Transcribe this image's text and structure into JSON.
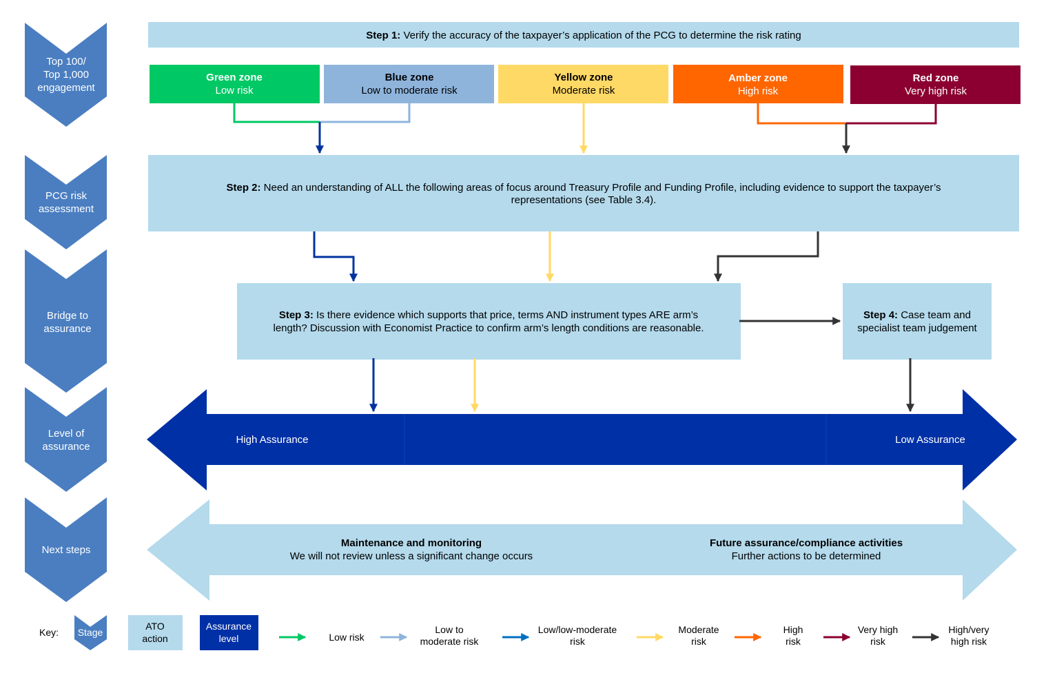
{
  "colors": {
    "stage": "#4a7ec1",
    "ato_action": "#b4daec",
    "assurance_level": "#0030a6",
    "green": "#00c864",
    "blue_zone": "#8eb4dc",
    "yellow": "#ffd966",
    "amber": "#ff6600",
    "red": "#8b0030",
    "low_moderate_arrow": "#0070c0",
    "step_blue_arrow": "#0033a0",
    "dark_arrow": "#333333"
  },
  "stages": [
    {
      "lines": [
        "Top 100/",
        "Top 1,000",
        "engagement"
      ]
    },
    {
      "lines": [
        "PCG risk",
        "assessment"
      ]
    },
    {
      "lines": [
        "Bridge to",
        "assurance"
      ]
    },
    {
      "lines": [
        "Level of",
        "assurance"
      ]
    },
    {
      "lines": [
        "Next steps"
      ]
    }
  ],
  "step1": {
    "label": "Step 1:",
    "text": " Verify the accuracy of the taxpayer’s application of the PCG to determine the risk rating"
  },
  "zones": [
    {
      "name": "Green zone",
      "risk": "Low risk"
    },
    {
      "name": "Blue zone",
      "risk": "Low to moderate risk"
    },
    {
      "name": "Yellow zone",
      "risk": "Moderate risk"
    },
    {
      "name": "Amber zone",
      "risk": "High risk"
    },
    {
      "name": "Red zone",
      "risk": "Very high risk"
    }
  ],
  "step2": {
    "label": "Step 2:",
    "line1": " Need an understanding of ALL the following areas of focus around Treasury Profile and Funding Profile, including evidence to support the taxpayer’s",
    "line2": "representations (see Table 3.4)."
  },
  "step3": {
    "label": "Step 3:",
    "line1": " Is there evidence which supports that price, terms AND instrument types ARE arm’s",
    "line2": "length? Discussion with Economist Practice to confirm arm’s length conditions are reasonable."
  },
  "step4": {
    "label": "Step 4:",
    "line1": " Case team and",
    "line2": "specialist team judgement"
  },
  "assurance": {
    "high": "High Assurance",
    "low": "Low Assurance"
  },
  "next_steps": {
    "left_title": "Maintenance and monitoring",
    "left_text": "We will not review unless a significant change occurs",
    "right_title": "Future assurance/compliance activities",
    "right_text": "Further actions to be determined"
  },
  "key": {
    "label": "Key:",
    "stage": "Stage",
    "ato_action": [
      "ATO",
      "action"
    ],
    "assurance_level": [
      "Assurance",
      "level"
    ],
    "arrows": [
      {
        "lines": [
          "Low risk"
        ],
        "color": "#00c864"
      },
      {
        "lines": [
          "Low to",
          "moderate risk"
        ],
        "color": "#8eb4dc"
      },
      {
        "lines": [
          "Low/low-moderate",
          "risk"
        ],
        "color": "#0070c0"
      },
      {
        "lines": [
          "Moderate",
          "risk"
        ],
        "color": "#ffd966"
      },
      {
        "lines": [
          "High",
          "risk"
        ],
        "color": "#ff6600"
      },
      {
        "lines": [
          "Very high",
          "risk"
        ],
        "color": "#8b0030"
      },
      {
        "lines": [
          "High/very",
          "high risk"
        ],
        "color": "#333333"
      }
    ]
  }
}
